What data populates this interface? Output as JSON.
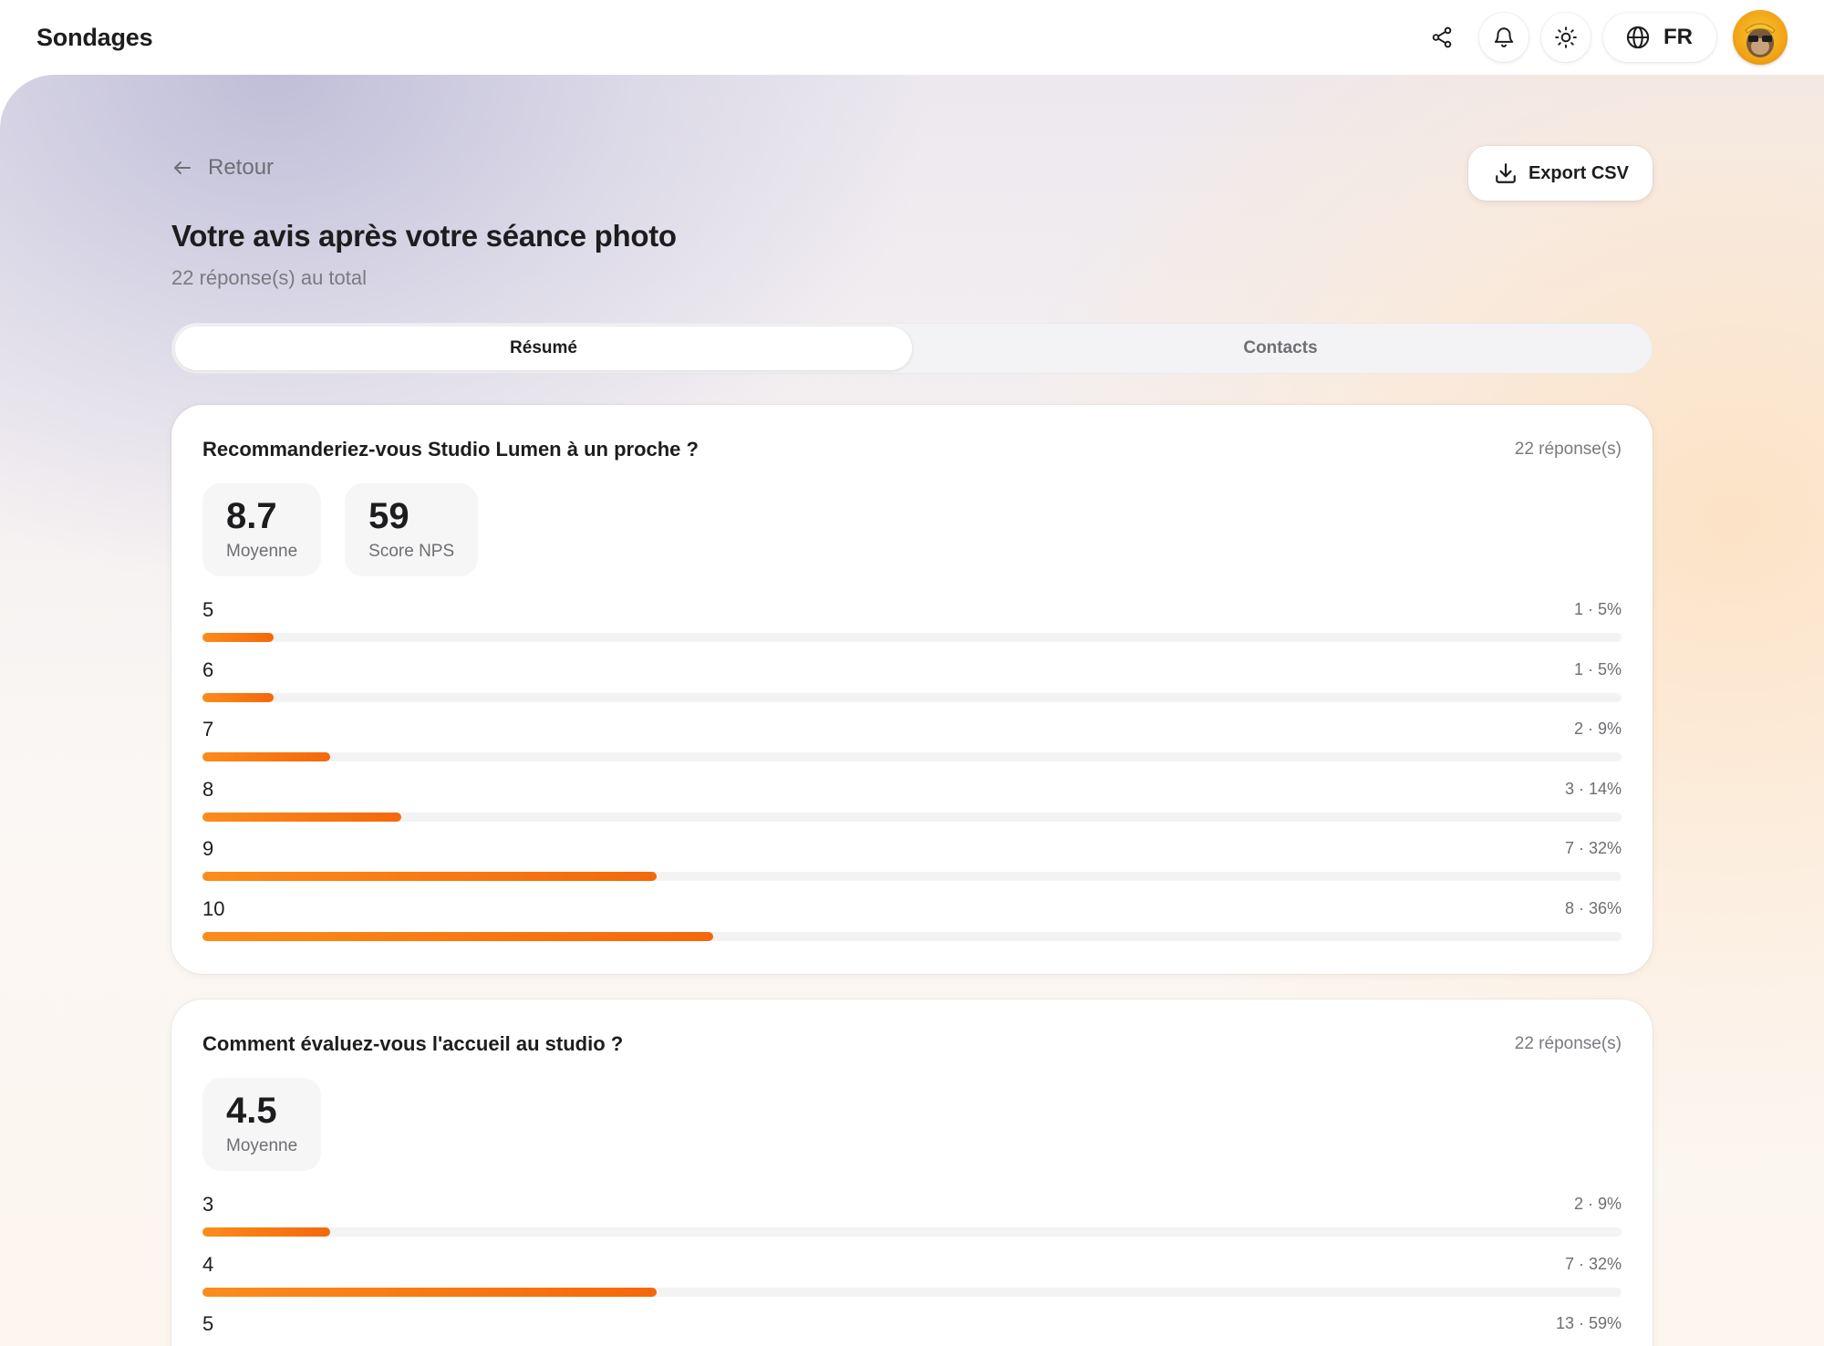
{
  "header": {
    "app_title": "Sondages",
    "language": "FR",
    "icons": [
      "share-icon",
      "bell-icon",
      "sun-icon",
      "globe-icon"
    ]
  },
  "page": {
    "back_label": "Retour",
    "export_label": "Export CSV",
    "title": "Votre avis après votre séance photo",
    "subtitle": "22 réponse(s) au total"
  },
  "tabs": [
    {
      "label": "Résumé",
      "active": true
    },
    {
      "label": "Contacts",
      "active": false
    }
  ],
  "accent_color": "#f4680b",
  "questions": [
    {
      "title": "Recommanderiez-vous Studio Lumen à un proche ?",
      "responses": "22 réponse(s)",
      "stats": [
        {
          "value": "8.7",
          "label": "Moyenne"
        },
        {
          "value": "59",
          "label": "Score NPS"
        }
      ],
      "distribution": [
        {
          "label": "5",
          "count": 1,
          "percent": 5,
          "meta": "1 · 5%"
        },
        {
          "label": "6",
          "count": 1,
          "percent": 5,
          "meta": "1 · 5%"
        },
        {
          "label": "7",
          "count": 2,
          "percent": 9,
          "meta": "2 · 9%"
        },
        {
          "label": "8",
          "count": 3,
          "percent": 14,
          "meta": "3 · 14%"
        },
        {
          "label": "9",
          "count": 7,
          "percent": 32,
          "meta": "7 · 32%"
        },
        {
          "label": "10",
          "count": 8,
          "percent": 36,
          "meta": "8 · 36%"
        }
      ]
    },
    {
      "title": "Comment évaluez-vous l'accueil au studio ?",
      "responses": "22 réponse(s)",
      "stats": [
        {
          "value": "4.5",
          "label": "Moyenne"
        }
      ],
      "distribution": [
        {
          "label": "3",
          "count": 2,
          "percent": 9,
          "meta": "2 · 9%"
        },
        {
          "label": "4",
          "count": 7,
          "percent": 32,
          "meta": "7 · 32%"
        },
        {
          "label": "5",
          "count": 13,
          "percent": 59,
          "meta": "13 · 59%"
        }
      ]
    }
  ]
}
